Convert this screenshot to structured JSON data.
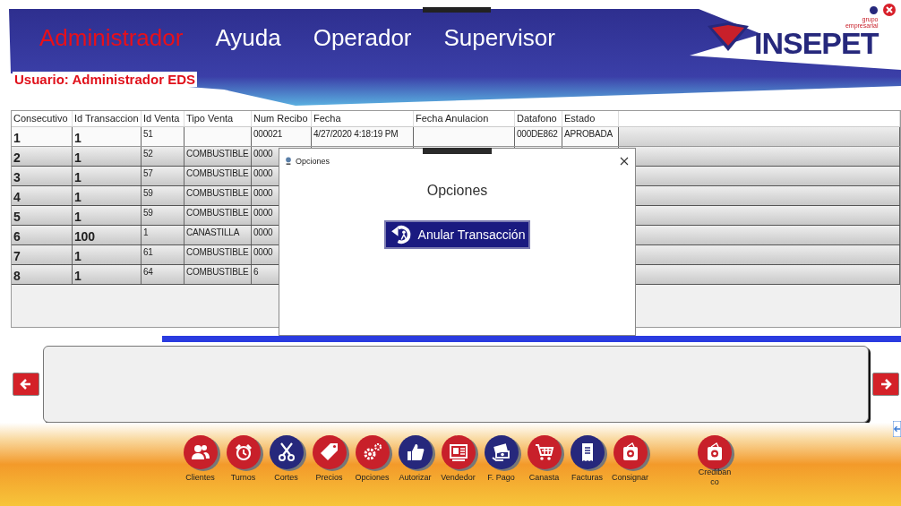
{
  "header": {
    "menu": [
      {
        "label": "Administrador",
        "selected": true
      },
      {
        "label": "Ayuda",
        "selected": false
      },
      {
        "label": "Operador",
        "selected": false
      },
      {
        "label": "Supervisor",
        "selected": false
      }
    ],
    "user": "Usuario: Administrador EDS",
    "logo": {
      "small_top": "grupo",
      "small_bottom": "empresarial",
      "name": "INSEPET"
    }
  },
  "table": {
    "columns": [
      "Consecutivo",
      "Id Transaccion",
      "Id Venta",
      "Tipo Venta",
      "Num Recibo",
      "Fecha",
      "Fecha Anulacion",
      "Datafono",
      "Estado"
    ],
    "rows": [
      {
        "selected": true,
        "cells": [
          "1",
          "1",
          "51",
          null,
          "000021",
          "4/27/2020 4:18:19 PM",
          null,
          "000DE862",
          "APROBADA"
        ]
      },
      {
        "selected": false,
        "cells": [
          "2",
          "1",
          "52",
          "COMBUSTIBLE",
          "0000"
        ]
      },
      {
        "selected": false,
        "cells": [
          "3",
          "1",
          "57",
          "COMBUSTIBLE",
          "0000"
        ]
      },
      {
        "selected": false,
        "cells": [
          "4",
          "1",
          "59",
          "COMBUSTIBLE",
          "0000"
        ]
      },
      {
        "selected": false,
        "cells": [
          "5",
          "1",
          "59",
          "COMBUSTIBLE",
          "0000"
        ]
      },
      {
        "selected": false,
        "cells": [
          "6",
          "100",
          "1",
          "CANASTILLA",
          "0000"
        ]
      },
      {
        "selected": false,
        "cells": [
          "7",
          "1",
          "61",
          "COMBUSTIBLE",
          "0000"
        ]
      },
      {
        "selected": false,
        "cells": [
          "8",
          "1",
          "64",
          "COMBUSTIBLE",
          "6"
        ]
      }
    ]
  },
  "dialog": {
    "title": "Opciones",
    "heading": "Opciones",
    "button": "Anular Transacción"
  },
  "toolbar": [
    {
      "label": "Clientes",
      "color": "#c8202a"
    },
    {
      "label": "Turnos",
      "color": "#c8202a"
    },
    {
      "label": "Cortes",
      "color": "#26287c"
    },
    {
      "label": "Precios",
      "color": "#c8202a"
    },
    {
      "label": "Opciones",
      "color": "#c8202a"
    },
    {
      "label": "Autorizar",
      "color": "#26287c"
    },
    {
      "label": "Vendedor",
      "color": "#c8202a"
    },
    {
      "label": "F. Pago",
      "color": "#26287c"
    },
    {
      "label": "Canasta",
      "color": "#c8202a"
    },
    {
      "label": "Facturas",
      "color": "#26287c"
    },
    {
      "label": "Consignar",
      "color": "#c8202a"
    },
    {
      "label": "Credibanco",
      "color": "#c8202a"
    }
  ]
}
